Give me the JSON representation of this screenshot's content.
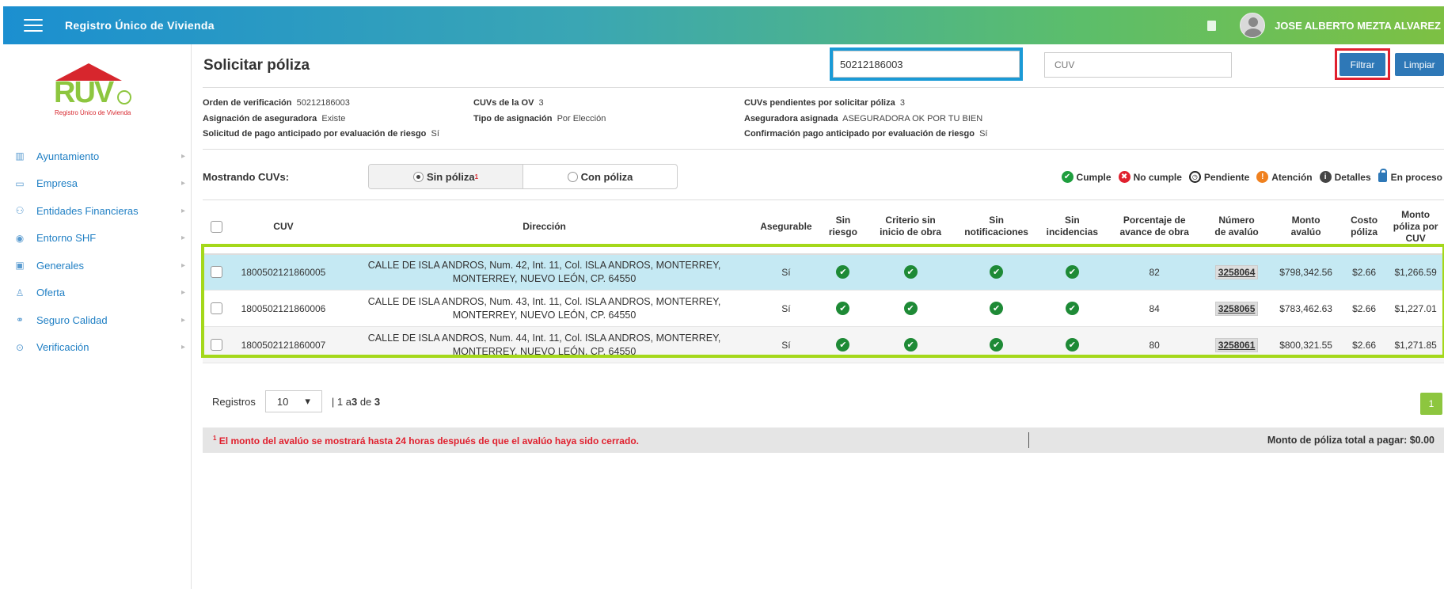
{
  "header": {
    "app_title": "Registro Único de Vivienda",
    "user_name": "JOSE ALBERTO MEZTA ALVAREZ"
  },
  "logo": {
    "text": "RUV",
    "subtitle": "Registro Único de Vivienda"
  },
  "sidebar": {
    "items": [
      {
        "label": "Ayuntamiento",
        "icon": "map-icon"
      },
      {
        "label": "Empresa",
        "icon": "building-icon"
      },
      {
        "label": "Entidades Financieras",
        "icon": "people-icon"
      },
      {
        "label": "Entorno SHF",
        "icon": "target-icon"
      },
      {
        "label": "Generales",
        "icon": "image-icon"
      },
      {
        "label": "Oferta",
        "icon": "user-icon"
      },
      {
        "label": "Seguro Calidad",
        "icon": "handshake-icon"
      },
      {
        "label": "Verificación",
        "icon": "check-circle-icon"
      }
    ]
  },
  "page": {
    "title": "Solicitar póliza",
    "search_value": "50212186003",
    "cuv_placeholder": "CUV",
    "filter_label": "Filtrar",
    "clear_label": "Limpiar"
  },
  "info": {
    "orden_label": "Orden de verificación",
    "orden_value": "50212186003",
    "cuvs_ov_label": "CUVs de la OV",
    "cuvs_ov_value": "3",
    "pend_label": "CUVs pendientes por solicitar póliza",
    "pend_value": "3",
    "asig_label": "Asignación de aseguradora",
    "asig_value": "Existe",
    "tipo_label": "Tipo de asignación",
    "tipo_value": "Por Elección",
    "aseg_label": "Aseguradora asignada",
    "aseg_value": "ASEGURADORA OK POR TU BIEN",
    "sol_label": "Solicitud de pago anticipado por evaluación de riesgo",
    "sol_value": "Sí",
    "conf_label": "Confirmación pago anticipado por evaluación de riesgo",
    "conf_value": "Sí"
  },
  "filter": {
    "showing_label": "Mostrando CUVs:",
    "option_without": "Sin póliza",
    "option_with": "Con póliza",
    "footnote_mark": "1"
  },
  "legend": {
    "cumple": "Cumple",
    "no_cumple": "No cumple",
    "pendiente": "Pendiente",
    "atencion": "Atención",
    "detalles": "Detalles",
    "en_proceso": "En proceso"
  },
  "table": {
    "headers": {
      "cuv": "CUV",
      "direccion": "Dirección",
      "asegurable": "Asegurable",
      "sin_riesgo_1": "Sin",
      "sin_riesgo_2": "riesgo",
      "criterio_1": "Criterio sin",
      "criterio_2": "inicio de obra",
      "notif_1": "Sin",
      "notif_2": "notificaciones",
      "inc_1": "Sin",
      "inc_2": "incidencias",
      "porc_1": "Porcentaje de",
      "porc_2": "avance de obra",
      "num_1": "Número",
      "num_2": "de avalúo",
      "monto_1": "Monto",
      "monto_2": "avalúo",
      "costo_1": "Costo",
      "costo_2": "póliza",
      "mp_1": "Monto",
      "mp_2": "póliza por",
      "mp_3": "CUV"
    },
    "rows": [
      {
        "cuv": "1800502121860005",
        "dir_1": "CALLE DE ISLA ANDROS, Num. 42, Int. 11, Col. ISLA ANDROS, MONTERREY,",
        "dir_2": "MONTERREY, NUEVO LEÓN, CP. 64550",
        "asegurable": "Sí",
        "avance": "82",
        "avaluo": "3258064",
        "monto_avaluo": "$798,342.56",
        "costo": "$2.66",
        "monto_poliza": "$1,266.59"
      },
      {
        "cuv": "1800502121860006",
        "dir_1": "CALLE DE ISLA ANDROS, Num. 43, Int. 11, Col. ISLA ANDROS, MONTERREY,",
        "dir_2": "MONTERREY, NUEVO LEÓN, CP. 64550",
        "asegurable": "Sí",
        "avance": "84",
        "avaluo": "3258065",
        "monto_avaluo": "$783,462.63",
        "costo": "$2.66",
        "monto_poliza": "$1,227.01"
      },
      {
        "cuv": "1800502121860007",
        "dir_1": "CALLE DE ISLA ANDROS, Num. 44, Int. 11, Col. ISLA ANDROS, MONTERREY,",
        "dir_2": "MONTERREY, NUEVO LEÓN, CP. 64550",
        "asegurable": "Sí",
        "avance": "80",
        "avaluo": "3258061",
        "monto_avaluo": "$800,321.55",
        "costo": "$2.66",
        "monto_poliza": "$1,271.85"
      }
    ]
  },
  "pagination": {
    "records_label": "Registros",
    "page_size": "10",
    "range_prefix": "| 1 a ",
    "range_to": "3",
    "range_of": " de ",
    "range_total": "3",
    "current_page": "1"
  },
  "footer": {
    "footnote_mark": "1",
    "footnote": " El monto del avalúo se mostrará hasta 24 horas después de que el avalúo haya sido cerrado.",
    "total": "Monto de póliza total a pagar: $0.00"
  },
  "colors": {
    "accent_blue": "#2e78b7",
    "highlight_search": "#1a9ad6",
    "highlight_filter": "#e0202e",
    "highlight_rows": "#a4d81a",
    "status_ok": "#1e8a36"
  }
}
